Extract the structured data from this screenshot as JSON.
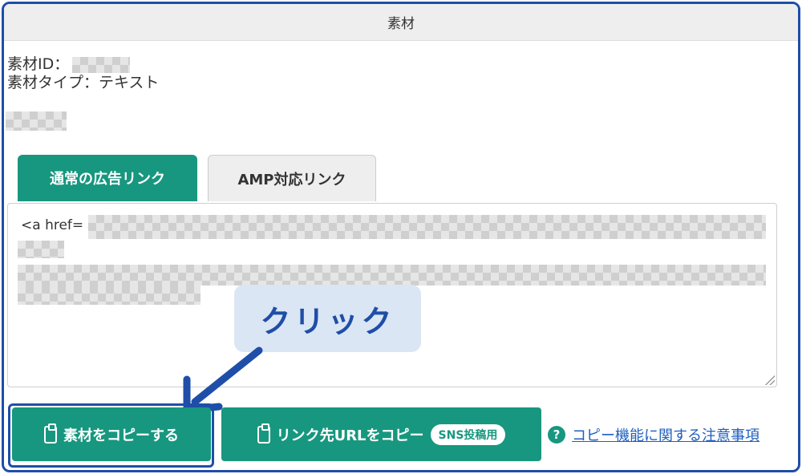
{
  "panel": {
    "title": "素材"
  },
  "meta": {
    "id_label": "素材ID：",
    "type_label": "素材タイプ：テキスト"
  },
  "tabs": [
    {
      "label": "通常の広告リンク",
      "active": true
    },
    {
      "label": "AMP対応リンク",
      "active": false
    }
  ],
  "code": {
    "prefix": "<a href="
  },
  "callout": {
    "text": "クリック"
  },
  "buttons": {
    "copy_material": "素材をコピーする",
    "copy_link_url": "リンク先URLをコピー",
    "sns_badge": "SNS投稿用"
  },
  "note": {
    "link_text": "コピー機能に関する注意事項",
    "icon_glyph": "?"
  },
  "colors": {
    "accent": "#17977f",
    "highlight": "#1f4ea8",
    "callout_bg": "#dbe6f4"
  }
}
